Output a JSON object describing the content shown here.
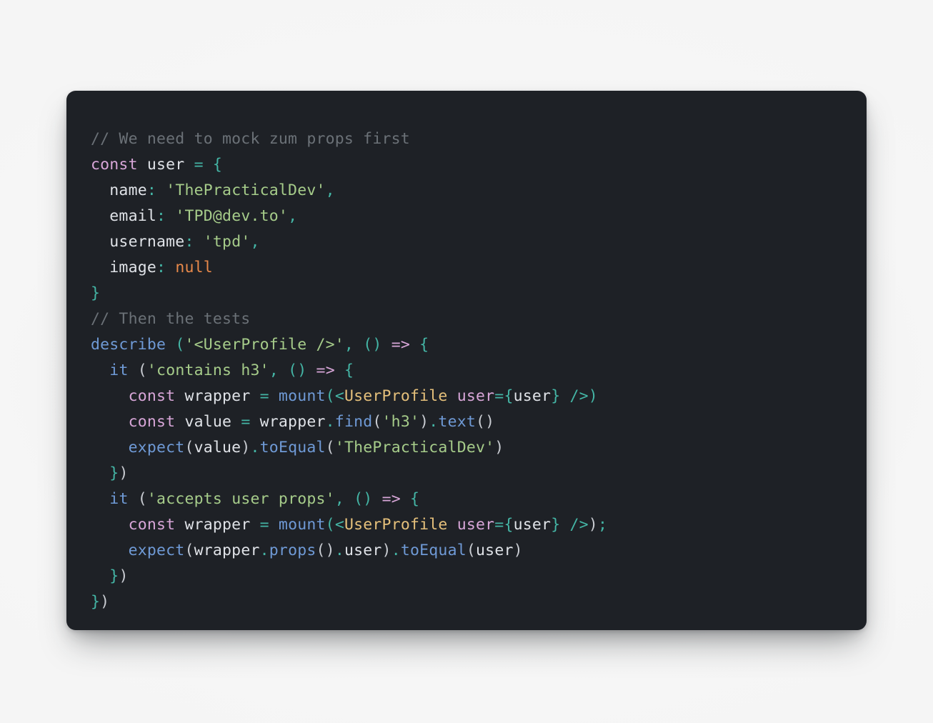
{
  "window": {
    "background_color": "#f4f4f4",
    "card_background_color": "#1e2126"
  },
  "theme": {
    "comment": "#6b7177",
    "keyword": "#d8a6d8",
    "plain": "#dfe2e7",
    "operator": "#44b5a5",
    "punctuation": "#44b5a5",
    "string": "#a6cc8a",
    "null_literal": "#e8894a",
    "function": "#6f9ad6",
    "jsx_tag": "#e5c07b",
    "jsx_attribute": "#d8a6d8"
  },
  "code": {
    "language": "javascript",
    "plain_text": "// We need to mock zum props first\nconst user = {\n  name: 'ThePracticalDev',\n  email: 'TPD@dev.to',\n  username: 'tpd',\n  image: null\n}\n// Then the tests\ndescribe ('<UserProfile />', () => {\n  it ('contains h3', () => {\n    const wrapper = mount(<UserProfile user={user} />)\n    const value = wrapper.find('h3').text()\n    expect(value).toEqual('ThePracticalDev')\n  })\n  it ('accepts user props', () => {\n    const wrapper = mount(<UserProfile user={user} />);\n    expect(wrapper.props().user).toEqual(user)\n  })\n})",
    "lines": [
      {
        "n": 1,
        "tokens": [
          {
            "t": "comment",
            "v": "// We need to mock zum props first"
          }
        ]
      },
      {
        "n": 2,
        "tokens": [
          {
            "t": "keyword",
            "v": "const"
          },
          {
            "t": "plain",
            "v": " user "
          },
          {
            "t": "op",
            "v": "="
          },
          {
            "t": "plain",
            "v": " "
          },
          {
            "t": "punc",
            "v": "{"
          }
        ]
      },
      {
        "n": 3,
        "tokens": [
          {
            "t": "plain",
            "v": "  name"
          },
          {
            "t": "punc",
            "v": ":"
          },
          {
            "t": "plain",
            "v": " "
          },
          {
            "t": "string",
            "v": "'ThePracticalDev'"
          },
          {
            "t": "punc",
            "v": ","
          }
        ]
      },
      {
        "n": 4,
        "tokens": [
          {
            "t": "plain",
            "v": "  email"
          },
          {
            "t": "punc",
            "v": ":"
          },
          {
            "t": "plain",
            "v": " "
          },
          {
            "t": "string",
            "v": "'TPD@dev.to'"
          },
          {
            "t": "punc",
            "v": ","
          }
        ]
      },
      {
        "n": 5,
        "tokens": [
          {
            "t": "plain",
            "v": "  username"
          },
          {
            "t": "punc",
            "v": ":"
          },
          {
            "t": "plain",
            "v": " "
          },
          {
            "t": "string",
            "v": "'tpd'"
          },
          {
            "t": "punc",
            "v": ","
          }
        ]
      },
      {
        "n": 6,
        "tokens": [
          {
            "t": "plain",
            "v": "  image"
          },
          {
            "t": "punc",
            "v": ":"
          },
          {
            "t": "plain",
            "v": " "
          },
          {
            "t": "null",
            "v": "null"
          }
        ]
      },
      {
        "n": 7,
        "tokens": [
          {
            "t": "punc",
            "v": "}"
          }
        ]
      },
      {
        "n": 8,
        "tokens": [
          {
            "t": "comment",
            "v": "// Then the tests"
          }
        ]
      },
      {
        "n": 9,
        "tokens": [
          {
            "t": "func",
            "v": "describe"
          },
          {
            "t": "plain",
            "v": " "
          },
          {
            "t": "punc",
            "v": "("
          },
          {
            "t": "string",
            "v": "'<UserProfile />'"
          },
          {
            "t": "punc",
            "v": ","
          },
          {
            "t": "plain",
            "v": " "
          },
          {
            "t": "punc",
            "v": "()"
          },
          {
            "t": "plain",
            "v": " "
          },
          {
            "t": "keyword",
            "v": "=>"
          },
          {
            "t": "plain",
            "v": " "
          },
          {
            "t": "punc",
            "v": "{"
          }
        ]
      },
      {
        "n": 10,
        "tokens": [
          {
            "t": "plain",
            "v": "  "
          },
          {
            "t": "func",
            "v": "it"
          },
          {
            "t": "plain",
            "v": " "
          },
          {
            "t": "paren",
            "v": "("
          },
          {
            "t": "string",
            "v": "'contains h3'"
          },
          {
            "t": "punc",
            "v": ","
          },
          {
            "t": "plain",
            "v": " "
          },
          {
            "t": "punc",
            "v": "()"
          },
          {
            "t": "plain",
            "v": " "
          },
          {
            "t": "keyword",
            "v": "=>"
          },
          {
            "t": "plain",
            "v": " "
          },
          {
            "t": "punc",
            "v": "{"
          }
        ]
      },
      {
        "n": 11,
        "tokens": [
          {
            "t": "plain",
            "v": "    "
          },
          {
            "t": "keyword",
            "v": "const"
          },
          {
            "t": "plain",
            "v": " wrapper "
          },
          {
            "t": "op",
            "v": "="
          },
          {
            "t": "plain",
            "v": " "
          },
          {
            "t": "func",
            "v": "mount"
          },
          {
            "t": "punc",
            "v": "("
          },
          {
            "t": "punc",
            "v": "<"
          },
          {
            "t": "tag",
            "v": "UserProfile"
          },
          {
            "t": "plain",
            "v": " "
          },
          {
            "t": "attr",
            "v": "user"
          },
          {
            "t": "op",
            "v": "="
          },
          {
            "t": "punc",
            "v": "{"
          },
          {
            "t": "plain",
            "v": "user"
          },
          {
            "t": "punc",
            "v": "}"
          },
          {
            "t": "plain",
            "v": " "
          },
          {
            "t": "punc",
            "v": "/>"
          },
          {
            "t": "punc",
            "v": ")"
          }
        ]
      },
      {
        "n": 12,
        "tokens": [
          {
            "t": "plain",
            "v": "    "
          },
          {
            "t": "keyword",
            "v": "const"
          },
          {
            "t": "plain",
            "v": " value "
          },
          {
            "t": "op",
            "v": "="
          },
          {
            "t": "plain",
            "v": " wrapper"
          },
          {
            "t": "dot",
            "v": "."
          },
          {
            "t": "func",
            "v": "find"
          },
          {
            "t": "paren",
            "v": "("
          },
          {
            "t": "string",
            "v": "'h3'"
          },
          {
            "t": "paren",
            "v": ")"
          },
          {
            "t": "dot",
            "v": "."
          },
          {
            "t": "func",
            "v": "text"
          },
          {
            "t": "paren",
            "v": "()"
          }
        ]
      },
      {
        "n": 13,
        "tokens": [
          {
            "t": "plain",
            "v": "    "
          },
          {
            "t": "func",
            "v": "expect"
          },
          {
            "t": "paren",
            "v": "("
          },
          {
            "t": "plain",
            "v": "value"
          },
          {
            "t": "paren",
            "v": ")"
          },
          {
            "t": "dot",
            "v": "."
          },
          {
            "t": "func",
            "v": "toEqual"
          },
          {
            "t": "paren",
            "v": "("
          },
          {
            "t": "string",
            "v": "'ThePracticalDev'"
          },
          {
            "t": "paren",
            "v": ")"
          }
        ]
      },
      {
        "n": 14,
        "tokens": [
          {
            "t": "plain",
            "v": "  "
          },
          {
            "t": "punc",
            "v": "}"
          },
          {
            "t": "paren",
            "v": ")"
          }
        ]
      },
      {
        "n": 15,
        "tokens": [
          {
            "t": "plain",
            "v": "  "
          },
          {
            "t": "func",
            "v": "it"
          },
          {
            "t": "plain",
            "v": " "
          },
          {
            "t": "paren",
            "v": "("
          },
          {
            "t": "string",
            "v": "'accepts user props'"
          },
          {
            "t": "punc",
            "v": ","
          },
          {
            "t": "plain",
            "v": " "
          },
          {
            "t": "punc",
            "v": "()"
          },
          {
            "t": "plain",
            "v": " "
          },
          {
            "t": "keyword",
            "v": "=>"
          },
          {
            "t": "plain",
            "v": " "
          },
          {
            "t": "punc",
            "v": "{"
          }
        ]
      },
      {
        "n": 16,
        "tokens": [
          {
            "t": "plain",
            "v": "    "
          },
          {
            "t": "keyword",
            "v": "const"
          },
          {
            "t": "plain",
            "v": " wrapper "
          },
          {
            "t": "op",
            "v": "="
          },
          {
            "t": "plain",
            "v": " "
          },
          {
            "t": "func",
            "v": "mount"
          },
          {
            "t": "punc",
            "v": "("
          },
          {
            "t": "punc",
            "v": "<"
          },
          {
            "t": "tag",
            "v": "UserProfile"
          },
          {
            "t": "plain",
            "v": " "
          },
          {
            "t": "attr",
            "v": "user"
          },
          {
            "t": "op",
            "v": "="
          },
          {
            "t": "punc",
            "v": "{"
          },
          {
            "t": "plain",
            "v": "user"
          },
          {
            "t": "punc",
            "v": "}"
          },
          {
            "t": "plain",
            "v": " "
          },
          {
            "t": "punc",
            "v": "/>"
          },
          {
            "t": "paren",
            "v": ")"
          },
          {
            "t": "punc",
            "v": ";"
          }
        ]
      },
      {
        "n": 17,
        "tokens": [
          {
            "t": "plain",
            "v": "    "
          },
          {
            "t": "func",
            "v": "expect"
          },
          {
            "t": "paren",
            "v": "("
          },
          {
            "t": "plain",
            "v": "wrapper"
          },
          {
            "t": "dot",
            "v": "."
          },
          {
            "t": "func",
            "v": "props"
          },
          {
            "t": "paren",
            "v": "()"
          },
          {
            "t": "dot",
            "v": "."
          },
          {
            "t": "plain",
            "v": "user"
          },
          {
            "t": "paren",
            "v": ")"
          },
          {
            "t": "dot",
            "v": "."
          },
          {
            "t": "func",
            "v": "toEqual"
          },
          {
            "t": "paren",
            "v": "("
          },
          {
            "t": "plain",
            "v": "user"
          },
          {
            "t": "paren",
            "v": ")"
          }
        ]
      },
      {
        "n": 18,
        "tokens": [
          {
            "t": "plain",
            "v": "  "
          },
          {
            "t": "punc",
            "v": "}"
          },
          {
            "t": "paren",
            "v": ")"
          }
        ]
      },
      {
        "n": 19,
        "tokens": [
          {
            "t": "punc",
            "v": "}"
          },
          {
            "t": "paren",
            "v": ")"
          }
        ]
      }
    ]
  }
}
